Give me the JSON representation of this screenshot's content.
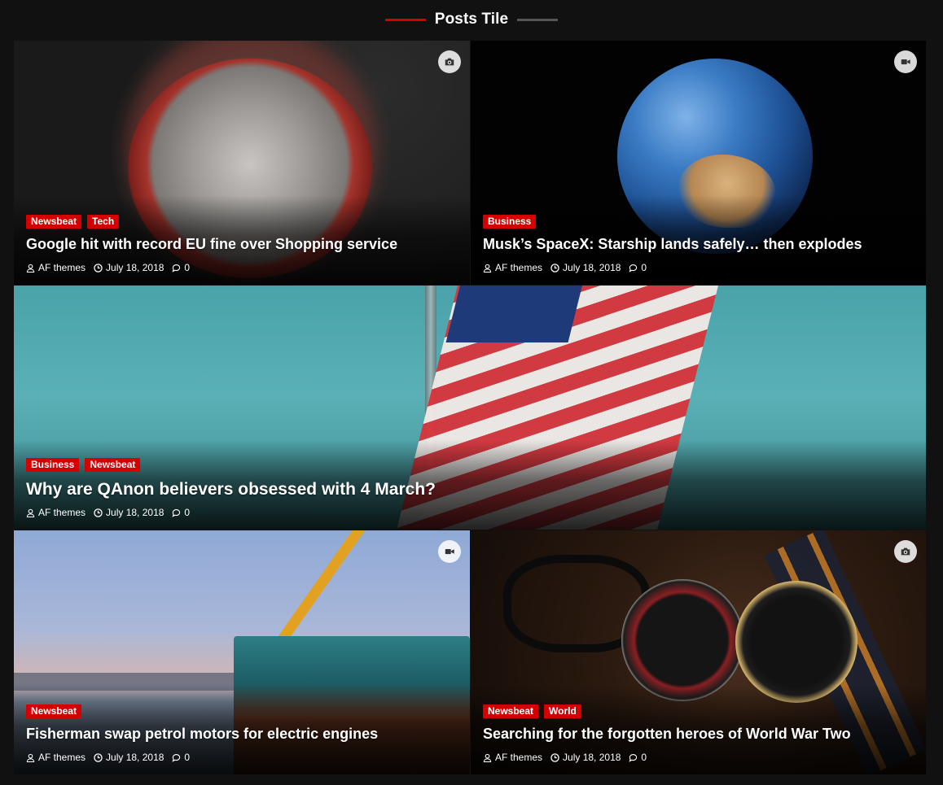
{
  "section": {
    "title": "Posts Tile"
  },
  "colors": {
    "accent": "#d40000",
    "background": "#111111"
  },
  "posts": [
    {
      "categories": [
        "Newsbeat",
        "Tech"
      ],
      "title": "Google hit with record EU fine over Shopping service",
      "author": "AF themes",
      "date": "July 18, 2018",
      "comments": "0",
      "format_icon": "camera-icon"
    },
    {
      "categories": [
        "Business"
      ],
      "title": "Musk’s SpaceX: Starship lands safely… then explodes",
      "author": "AF themes",
      "date": "July 18, 2018",
      "comments": "0",
      "format_icon": "video-icon"
    },
    {
      "categories": [
        "Business",
        "Newsbeat"
      ],
      "title": "Why are QAnon believers obsessed with 4 March?",
      "author": "AF themes",
      "date": "July 18, 2018",
      "comments": "0",
      "format_icon": ""
    },
    {
      "categories": [
        "Newsbeat"
      ],
      "title": "Fisherman swap petrol motors for electric engines",
      "author": "AF themes",
      "date": "July 18, 2018",
      "comments": "0",
      "format_icon": "video-icon"
    },
    {
      "categories": [
        "Newsbeat",
        "World"
      ],
      "title": "Searching for the forgotten heroes of World War Two",
      "author": "AF themes",
      "date": "July 18, 2018",
      "comments": "0",
      "format_icon": "camera-icon"
    }
  ]
}
